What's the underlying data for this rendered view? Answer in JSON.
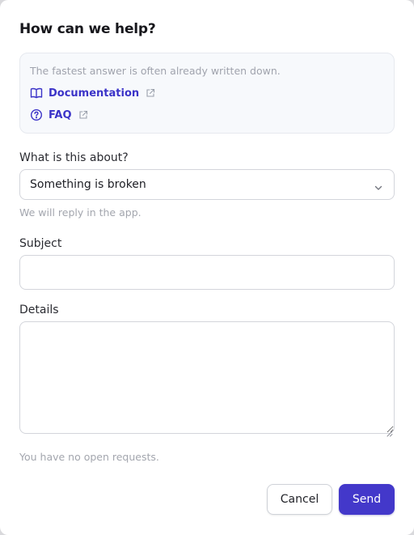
{
  "dialog": {
    "title": "How can we help?"
  },
  "help_box": {
    "hint": "The fastest answer is often already written down.",
    "links": [
      {
        "label": "Documentation",
        "icon": "book-icon",
        "external_icon": "external-link-icon"
      },
      {
        "label": "FAQ",
        "icon": "question-circle-icon",
        "external_icon": "external-link-icon"
      }
    ]
  },
  "form": {
    "topic": {
      "label": "What is this about?",
      "selected": "Something is broken",
      "icon": "chevron-down-icon",
      "hint": "We will reply in the app."
    },
    "subject": {
      "label": "Subject",
      "value": "",
      "placeholder": ""
    },
    "details": {
      "label": "Details",
      "value": "",
      "placeholder": ""
    },
    "status_text": "You have no open requests."
  },
  "actions": {
    "cancel_label": "Cancel",
    "send_label": "Send"
  },
  "colors": {
    "accent": "#4338ca",
    "link": "#3b33c8",
    "muted_text": "#a3a6ae",
    "help_box_bg": "#f7f9fc"
  }
}
